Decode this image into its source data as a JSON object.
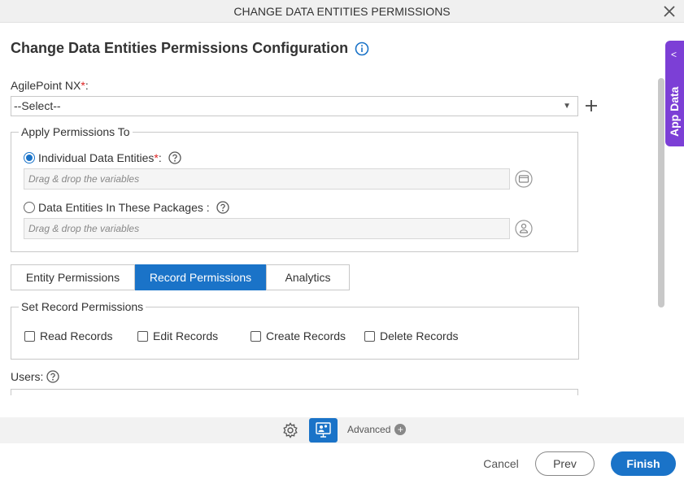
{
  "window": {
    "title": "CHANGE DATA ENTITIES PERMISSIONS"
  },
  "page": {
    "heading": "Change Data Entities Permissions Configuration"
  },
  "agilepoint": {
    "label": "AgilePoint NX",
    "required_mark": "*",
    "colon": ":",
    "selected": "--Select--"
  },
  "apply_permissions": {
    "legend": "Apply Permissions To",
    "individual": {
      "label": "Individual Data Entities",
      "required_mark": "*",
      "colon": " :",
      "placeholder": "Drag & drop the variables"
    },
    "packages": {
      "label": "Data Entities In These Packages :",
      "placeholder": "Drag & drop the variables"
    }
  },
  "tabs": [
    {
      "label": "Entity Permissions"
    },
    {
      "label": "Record Permissions"
    },
    {
      "label": "Analytics"
    }
  ],
  "record_permissions": {
    "legend": "Set Record Permissions",
    "checkboxes": [
      {
        "label": "Read Records"
      },
      {
        "label": "Edit Records"
      },
      {
        "label": "Create Records"
      },
      {
        "label": "Delete Records"
      }
    ]
  },
  "users": {
    "label": "Users:"
  },
  "side_panel": {
    "label": "App Data"
  },
  "toolbar": {
    "advanced_label": "Advanced"
  },
  "footer": {
    "cancel": "Cancel",
    "prev": "Prev",
    "finish": "Finish"
  },
  "colors": {
    "accent": "#1a73c8",
    "app_data": "#7c3fd6"
  }
}
